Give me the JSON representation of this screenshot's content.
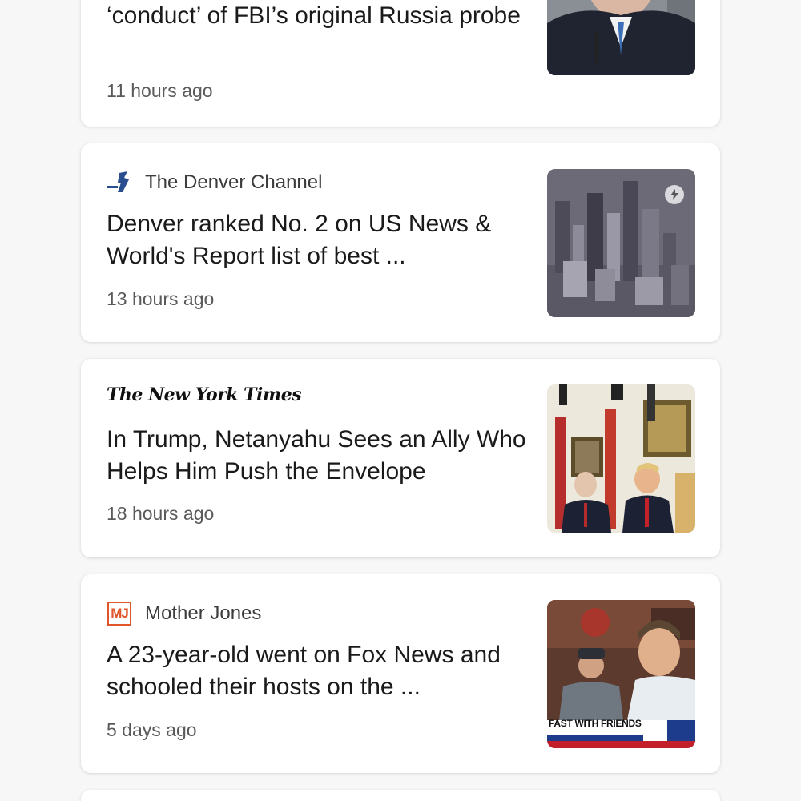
{
  "feed": {
    "cards": [
      {
        "headline": "‘conduct’ of FBI’s original Russia probe",
        "time": "11 hours ago",
        "thumb_icon": "thumbnail-man-in-suit"
      },
      {
        "source": "The Denver Channel",
        "source_icon": "denver-channel-logo-icon",
        "headline": "Denver ranked No. 2 on US News & World's Report list of best ...",
        "time": "13 hours ago",
        "thumb_icon": "thumbnail-city-aerial",
        "thumb_badge_icon": "amp-lightning-icon"
      },
      {
        "source": "The New York Times",
        "headline": "In Trump, Netanyahu Sees an Ally Who Helps Him Push the Envelope",
        "time": "18 hours ago",
        "thumb_icon": "thumbnail-two-leaders"
      },
      {
        "source": "Mother Jones",
        "source_icon_text": "MJ",
        "headline": "A 23-year-old went on Fox News and schooled their hosts on the ...",
        "time": "5 days ago",
        "thumb_icon": "thumbnail-tv-interview",
        "thumb_caption": "FAST WITH FRIENDS"
      }
    ]
  },
  "colors": {
    "background": "#f7f7f8",
    "card": "#ffffff",
    "headline": "#1a1a1a",
    "meta": "#5a5a5a",
    "mother_jones_orange": "#e2552a"
  }
}
